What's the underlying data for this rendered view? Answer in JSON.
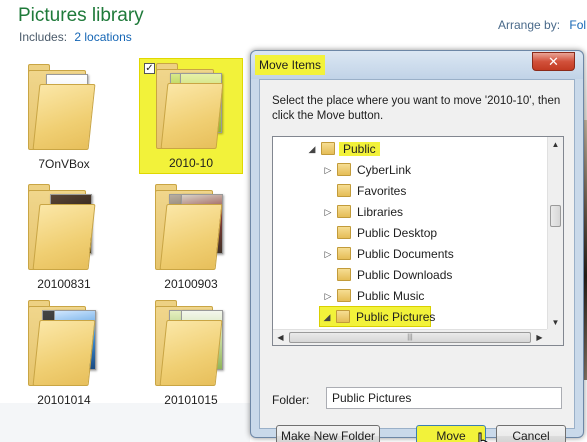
{
  "library": {
    "title": "Pictures library",
    "includes_label": "Includes:",
    "includes_link": "2 locations",
    "arrange_label": "Arrange by:",
    "arrange_value": "Fol"
  },
  "tiles": [
    {
      "label": "7OnVBox",
      "selected": false
    },
    {
      "label": "2010-10",
      "selected": true,
      "checkbox": "✓"
    },
    {
      "label": "20100831",
      "selected": false
    },
    {
      "label": "20100903",
      "selected": false
    },
    {
      "label": "20101014",
      "selected": false
    },
    {
      "label": "20101015",
      "selected": false
    }
  ],
  "dialog": {
    "title": "Move Items",
    "close_glyph": "✕",
    "prompt": "Select the place where you want to move '2010-10', then click the Move button.",
    "tree": [
      {
        "label": "Public",
        "arrow": "◢",
        "highlight": true
      },
      {
        "label": "CyberLink",
        "arrow": "▷"
      },
      {
        "label": "Favorites",
        "arrow": ""
      },
      {
        "label": "Libraries",
        "arrow": "▷"
      },
      {
        "label": "Public Desktop",
        "arrow": ""
      },
      {
        "label": "Public Documents",
        "arrow": "▷"
      },
      {
        "label": "Public Downloads",
        "arrow": ""
      },
      {
        "label": "Public Music",
        "arrow": "▷"
      },
      {
        "label": "Public Pictures",
        "arrow": "◢",
        "selected": true
      }
    ],
    "folder_label": "Folder:",
    "folder_value": "Public Pictures",
    "buttons": {
      "new_folder": "Make New Folder",
      "move": "Move",
      "cancel": "Cancel"
    },
    "scroll_glyphs": {
      "up": "▲",
      "down": "▼",
      "left": "◀",
      "right": "▶",
      "grip": "|||"
    }
  },
  "colors": {
    "highlight": "#f2f23a",
    "title_green": "#1f7a3a",
    "link_blue": "#1566b5"
  }
}
